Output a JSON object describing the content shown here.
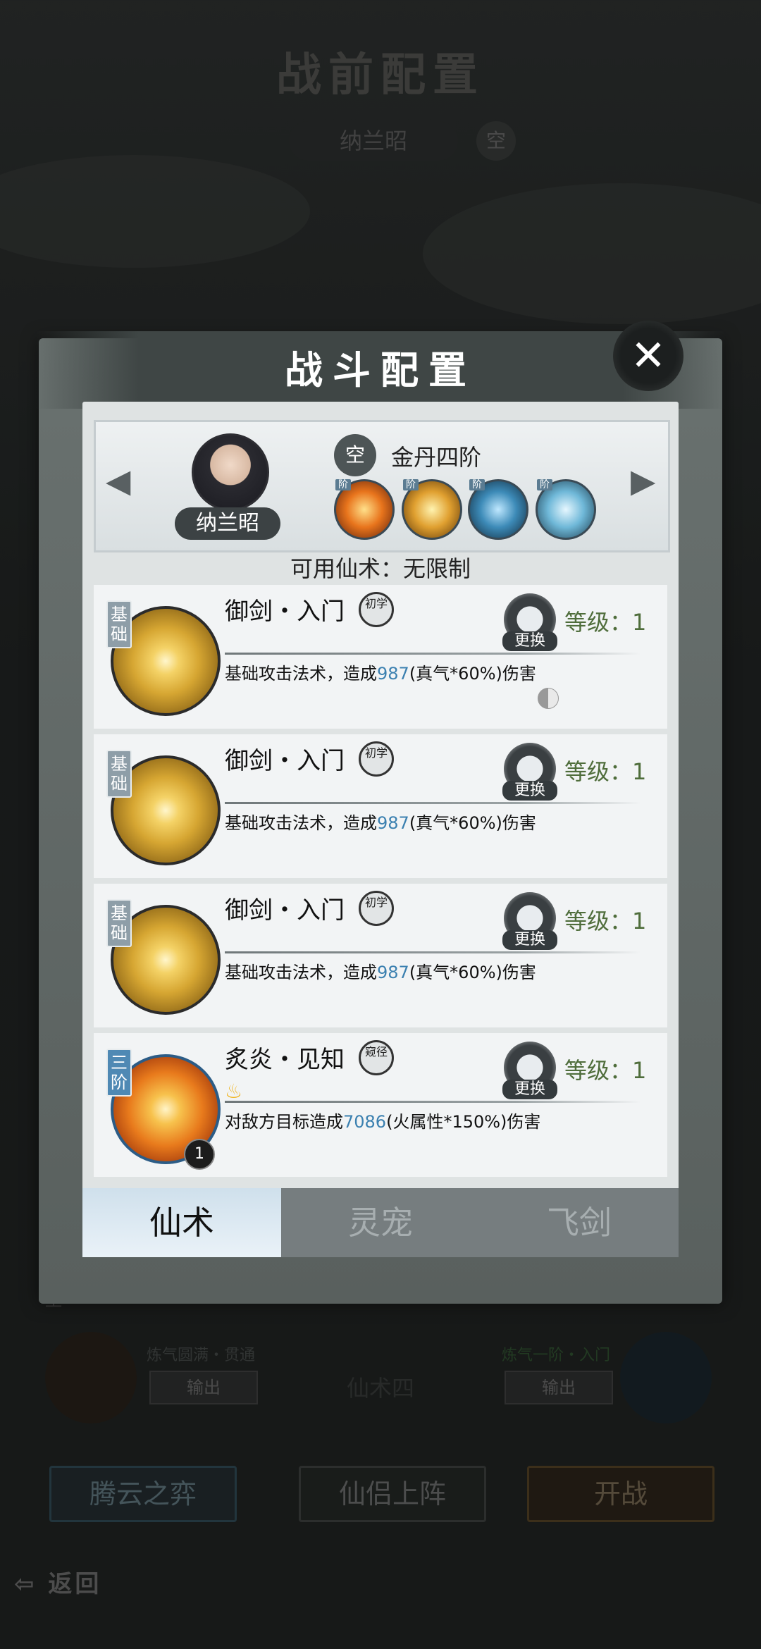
{
  "background": {
    "title": "战前配置",
    "hero_name": "纳兰昭",
    "empty_badge": "空",
    "side_labels": [
      "基础",
      "空",
      "基础",
      "空",
      "基础",
      "空"
    ],
    "left_slot_name": "炼气圆满・贯通",
    "right_slot_name": "炼气一阶・入门",
    "output_label": "输出",
    "center_slot_label": "仙术四",
    "bottom_buttons": [
      "腾云之弈",
      "仙侣上阵",
      "开战"
    ],
    "back_label": "返回"
  },
  "dialog": {
    "title": "战斗配置",
    "close_symbol": "✕",
    "hero": {
      "name": "纳兰昭",
      "realm_badge": "空",
      "realm": "金丹四阶",
      "prev_symbol": "◀",
      "next_symbol": "▶",
      "skill_icons": [
        {
          "icon": "fire-skill-icon",
          "tier": "阶",
          "color": "#d9641e"
        },
        {
          "icon": "fire-sword-skill-icon",
          "tier": "阶",
          "color": "#e0a030"
        },
        {
          "icon": "water-skill-icon",
          "tier": "阶",
          "color": "#3d8bb8"
        },
        {
          "icon": "ice-skill-icon",
          "tier": "阶",
          "color": "#6fb8d8"
        }
      ]
    },
    "available_spells": "可用仙术：无限制",
    "skills": [
      {
        "tag": "基础",
        "name": "御剑・入门",
        "stage": "初学",
        "swap_label": "更换",
        "level": "等级：1",
        "desc_prefix": "基础攻击法术，造成",
        "desc_value": "987",
        "desc_suffix": "(真气*60%)伤害"
      },
      {
        "tag": "基础",
        "name": "御剑・入门",
        "stage": "初学",
        "swap_label": "更换",
        "level": "等级：1",
        "desc_prefix": "基础攻击法术，造成",
        "desc_value": "987",
        "desc_suffix": "(真气*60%)伤害"
      },
      {
        "tag": "基础",
        "name": "御剑・入门",
        "stage": "初学",
        "swap_label": "更换",
        "level": "等级：1",
        "desc_prefix": "基础攻击法术，造成",
        "desc_value": "987",
        "desc_suffix": "(真气*60%)伤害"
      },
      {
        "tag": "三阶",
        "name": "炙炎・见知",
        "stage": "窥径",
        "swap_label": "更换",
        "level": "等级：1",
        "count": "1",
        "desc_prefix": "对敌方目标造成",
        "desc_value": "7086",
        "desc_suffix": "(火属性*150%)伤害"
      }
    ],
    "tabs": [
      {
        "label": "仙术",
        "active": true
      },
      {
        "label": "灵宠",
        "active": false
      },
      {
        "label": "飞剑",
        "active": false
      }
    ]
  }
}
